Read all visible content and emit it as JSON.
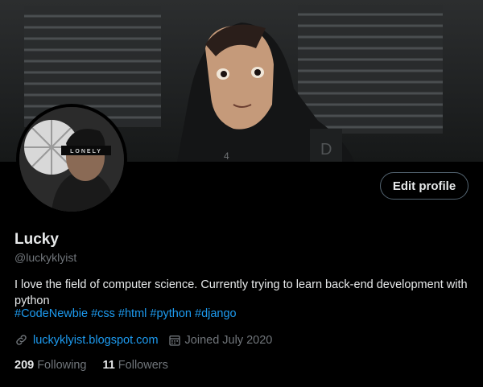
{
  "profile": {
    "name": "Lucky",
    "handle": "@luckyklyist",
    "bio": "I love the field of computer science. Currently trying to learn back-end development with python",
    "hashtags": [
      "#CodeNewbie",
      "#css",
      "#html",
      "#python",
      "#django"
    ],
    "website": "luckyklyist.blogspot.com",
    "joined": "Joined July 2020",
    "following_count": "209",
    "following_label": "Following",
    "followers_count": "11",
    "followers_label": "Followers",
    "avatar_text": "LONELY"
  },
  "actions": {
    "edit_profile_label": "Edit profile"
  },
  "icons": {
    "website": "link-icon",
    "joined": "calendar-icon"
  },
  "colors": {
    "background": "#000000",
    "accent": "#1d9bf0",
    "muted": "#71767b",
    "text": "#e7e9ea"
  }
}
